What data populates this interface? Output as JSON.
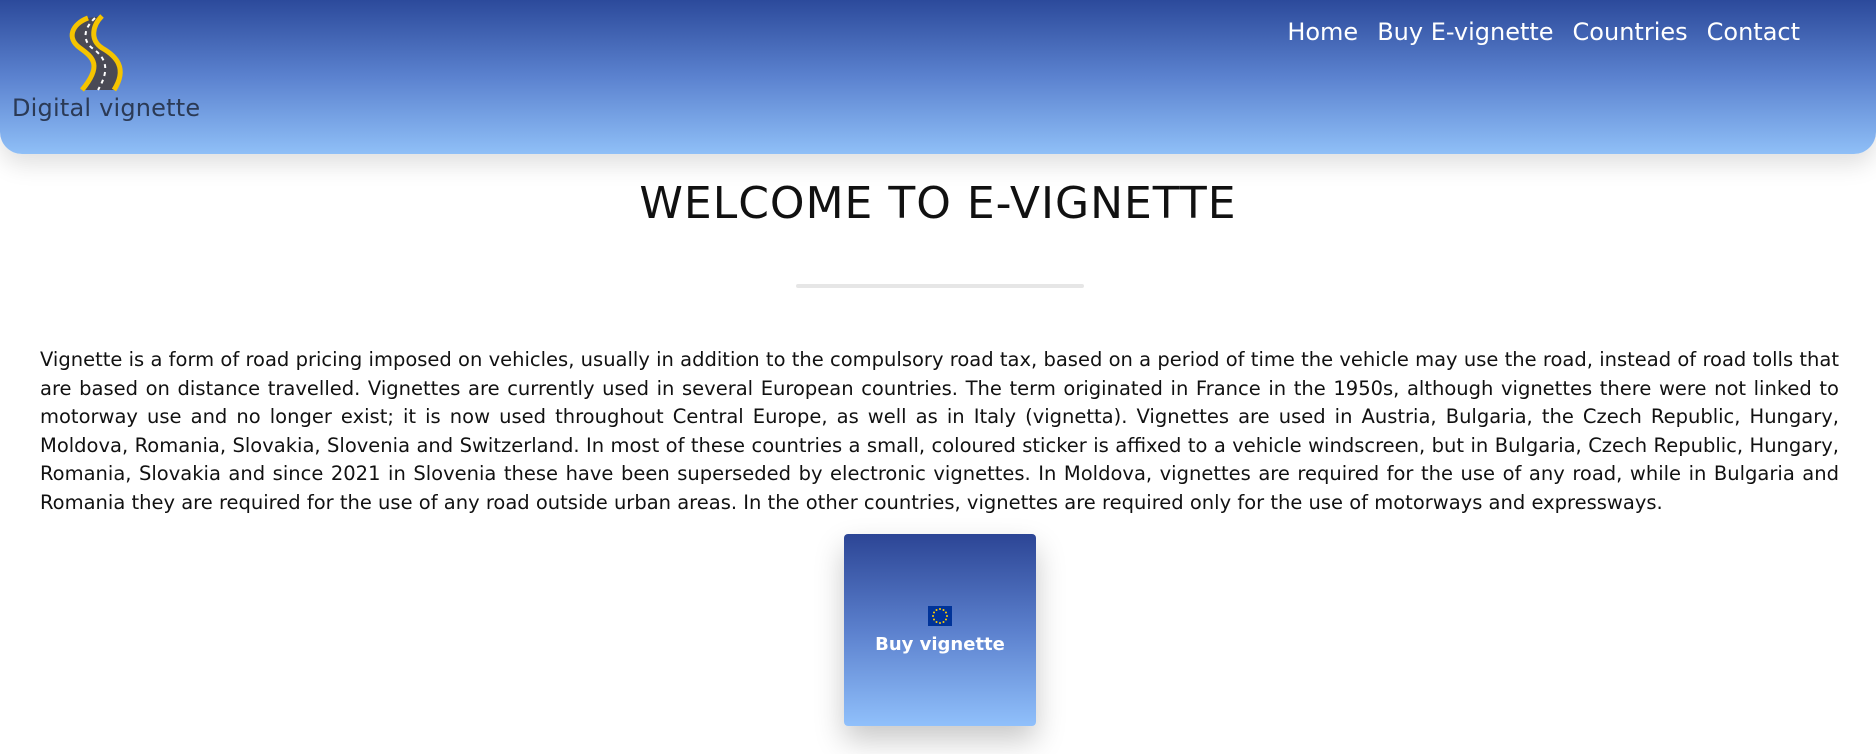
{
  "brand": {
    "name": "Digital vignette",
    "colors": {
      "header_top": "#2c4a9b",
      "header_bottom": "#8fbff7",
      "road": "#4a4a55",
      "road_edge": "#f5c400"
    }
  },
  "nav": {
    "items": [
      {
        "label": "Home"
      },
      {
        "label": "Buy E-vignette"
      },
      {
        "label": "Countries"
      },
      {
        "label": "Contact"
      }
    ]
  },
  "main": {
    "title": "WELCOME TO E-VIGNETTE",
    "intro": "Vignette is a form of road pricing imposed on vehicles, usually in addition to the compulsory road tax, based on a period of time the vehicle may use the road, instead of road tolls that are based on distance travelled. Vignettes are currently used in several European countries. The term originated in France in the 1950s, although vignettes there were not linked to motorway use and no longer exist; it is now used throughout Central Europe, as well as in Italy (vignetta). Vignettes are used in Austria, Bulgaria, the Czech Republic, Hungary, Moldova, Romania, Slovakia, Slovenia and Switzerland. In most of these countries a small, coloured sticker is affixed to a vehicle windscreen, but in Bulgaria, Czech Republic, Hungary, Romania, Slovakia and since 2021 in Slovenia these have been superseded by electronic vignettes. In Moldova, vignettes are required for the use of any road, while in Bulgaria and Romania they are required for the use of any road outside urban areas. In the other countries, vignettes are required only for the use of motorways and expressways."
  },
  "cta": {
    "label": "Buy vignette",
    "icon": "eu-flag-icon"
  }
}
